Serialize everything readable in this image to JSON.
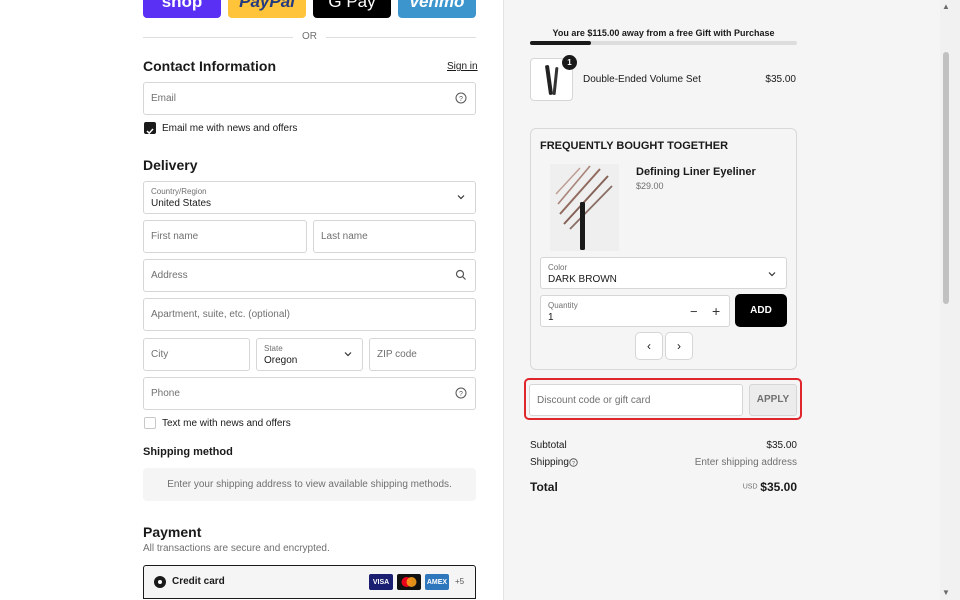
{
  "express": {
    "shop": "shop",
    "paypal": "PayPal",
    "gpay": "G Pay",
    "venmo": "venmo"
  },
  "or_label": "OR",
  "contact": {
    "title": "Contact Information",
    "sign_in": "Sign in",
    "email_placeholder": "Email",
    "email_opt_in": "Email me with news and offers"
  },
  "delivery": {
    "title": "Delivery",
    "country_label": "Country/Region",
    "country_value": "United States",
    "first_name": "First name",
    "last_name": "Last name",
    "address": "Address",
    "apartment": "Apartment, suite, etc. (optional)",
    "city": "City",
    "state_label": "State",
    "state_value": "Oregon",
    "zip": "ZIP code",
    "phone": "Phone",
    "text_opt_in": "Text me with news and offers"
  },
  "shipping": {
    "title": "Shipping method",
    "message": "Enter your shipping address to view available shipping methods."
  },
  "payment": {
    "title": "Payment",
    "subtitle": "All transactions are secure and encrypted.",
    "method": "Credit card",
    "cards": [
      "VISA",
      "MC",
      "AMEX"
    ],
    "more": "+5"
  },
  "summary": {
    "gift_message": "You are $115.00 away from a free Gift with Purchase",
    "gift_progress": 0.23,
    "item": {
      "name": "Double-Ended Volume Set",
      "price": "$35.00",
      "quantity": "1"
    },
    "fbt": {
      "title": "FREQUENTLY BOUGHT TOGETHER",
      "product_name": "Defining Liner Eyeliner",
      "product_price": "$29.00",
      "color_label": "Color",
      "color_value": "DARK BROWN",
      "qty_label": "Quantity",
      "qty_value": "1",
      "minus": "−",
      "plus": "+",
      "add": "ADD",
      "prev": "‹",
      "next": "›"
    },
    "discount_placeholder": "Discount code or gift card",
    "apply": "APPLY",
    "subtotal_label": "Subtotal",
    "subtotal_value": "$35.00",
    "shipping_label": "Shipping",
    "shipping_value": "Enter shipping address",
    "total_label": "Total",
    "currency": "USD",
    "total_value": "$35.00"
  },
  "colors": {
    "shop": "#5a31f4",
    "paypal": "#ffc439",
    "gpay": "#000000",
    "venmo": "#3d95ce",
    "highlight": "#e0262d"
  }
}
